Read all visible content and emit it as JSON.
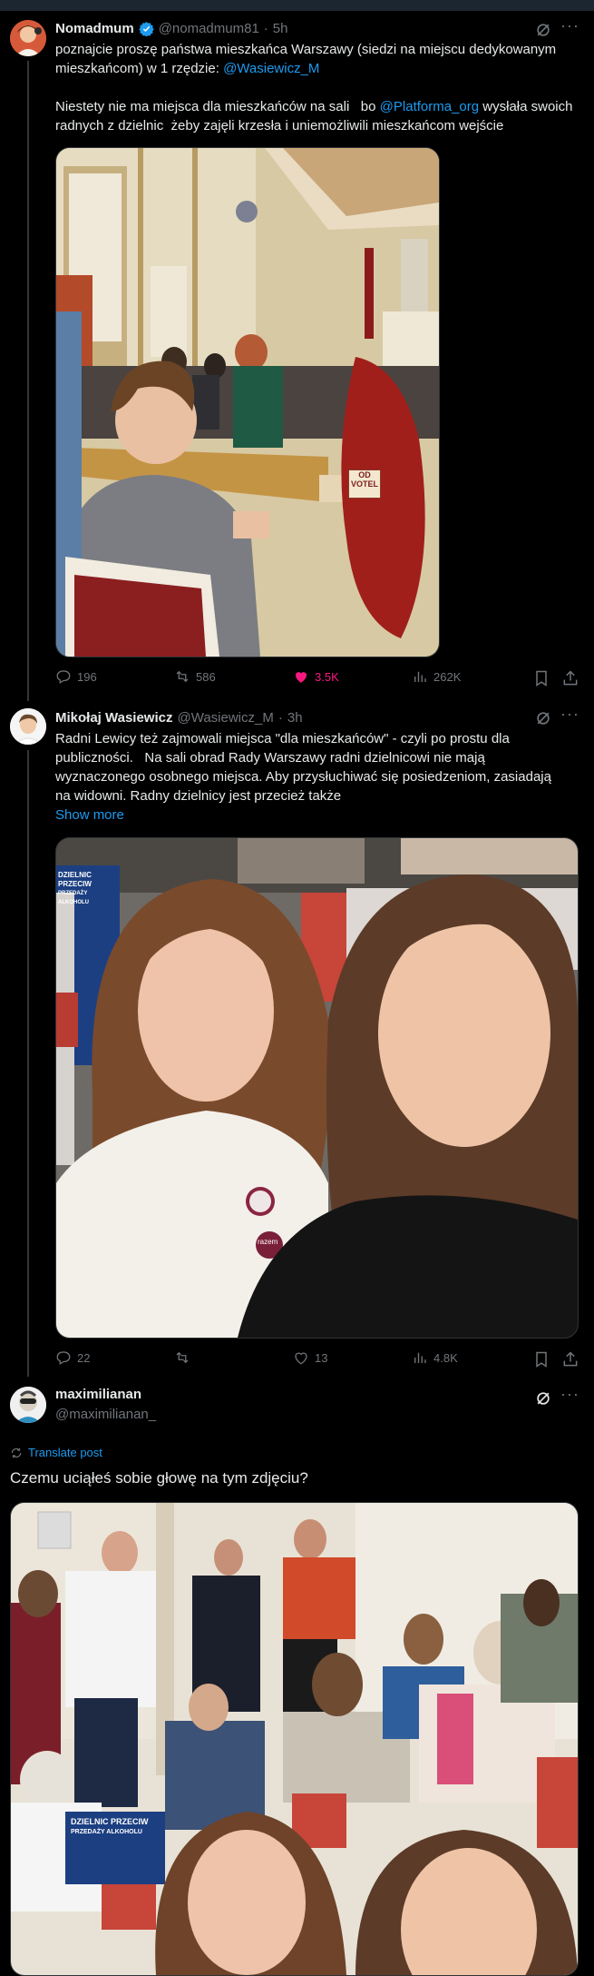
{
  "tweets": [
    {
      "name": "Nomadmum",
      "handle": "@nomadmum81",
      "sep": "·",
      "time": "5h",
      "text_part1": "poznajcie proszę państwa mieszkańca Warszawy (siedzi na miejscu dedykowanym mieszkańcom) w 1 rzędzie: ",
      "mention1": "@Wasiewicz_M",
      "text_part2": "Niestety nie ma miejsca dla mieszkańców na sali   bo ",
      "mention2": "@Platforma_org",
      "text_part3": " wysłała swoich radnych z dzielnic  żeby zajęli krzesła i uniemożliwili mieszkańcom wejście",
      "replies": "196",
      "reposts": "586",
      "likes": "3.5K",
      "views": "262K",
      "sign_text": "OD\nVOTEL"
    },
    {
      "name": "Mikołaj Wasiewicz",
      "handle": "@Wasiewicz_M",
      "sep": "·",
      "time": "3h",
      "text": "Radni Lewicy też zajmowali miejsca \"dla mieszkańców\" - czyli po prostu dla publiczności.   Na sali obrad Rady Warszawy radni dzielnicowi nie mają wyznaczonego osobnego miejsca. Aby przysłuchiwać się posiedzeniom, zasiadają na widowni. Radny dzielnicy jest przecież także",
      "show_more": "Show more",
      "banner_text": "DZIELNIC PRZECIW",
      "banner_sub": "PRZEDAŻY ALKOHOLU",
      "badge_text": "razem",
      "replies": "22",
      "reposts": "",
      "likes": "13",
      "views": "4.8K"
    },
    {
      "name": "maximilianan",
      "handle": "@maximilianan_",
      "translate": "Translate post",
      "text": "Czemu uciąłeś sobie głowę na tym zdjęciu?",
      "banner_text": "DZIELNIC PRZECIW",
      "banner_sub": "PRZEDAŻY ALKOHOLU"
    }
  ],
  "colors": {
    "background": "#000000",
    "text": "#e7e9ea",
    "muted": "#71767b",
    "link": "#1d9bf0",
    "like_active": "#f91880",
    "verified": "#1d9bf0"
  }
}
